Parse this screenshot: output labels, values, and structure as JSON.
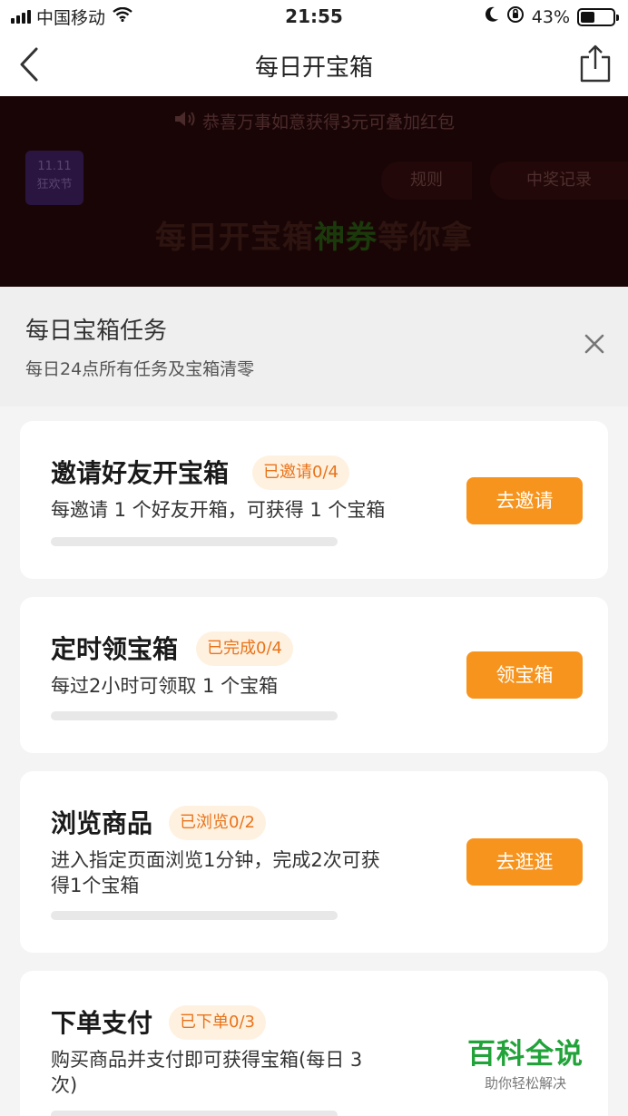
{
  "status_bar": {
    "carrier": "中国移动",
    "time": "21:55",
    "battery": "43%",
    "battery_level": 0.43
  },
  "nav": {
    "title": "每日开宝箱",
    "back_icon": "chevron-left-icon",
    "share_icon": "share-icon"
  },
  "banner": {
    "notice": "恭喜万事如意获得3元可叠加红包",
    "badge_line1": "11.11",
    "badge_line2": "狂欢节",
    "rules": "规则",
    "records": "中奖记录",
    "slogan_a": "每日开宝箱",
    "slogan_b": "神券",
    "slogan_c": "等你拿"
  },
  "sheet": {
    "title": "每日宝箱任务",
    "subtitle": "每日24点所有任务及宝箱清零",
    "close_icon": "close-icon"
  },
  "tasks": [
    {
      "title": "邀请好友开宝箱",
      "tag": "已邀请0/4",
      "desc": "每邀请 1 个好友开箱，可获得 1 个宝箱",
      "button": "去邀请",
      "progress": 0
    },
    {
      "title": "定时领宝箱",
      "tag": "已完成0/4",
      "desc": "每过2小时可领取 1 个宝箱",
      "button": "领宝箱",
      "progress": 0
    },
    {
      "title": "浏览商品",
      "tag": "已浏览0/2",
      "desc_line1": "进入指定页面浏览1分钟，完成2次可获",
      "desc_line2": "得1个宝箱",
      "button": "去逛逛",
      "progress": 0
    },
    {
      "title": "下单支付",
      "tag": "已下单0/3",
      "desc_line1": "购买商品并支付即可获得宝箱(每日 3",
      "desc_line2": "次)",
      "progress": 0
    }
  ],
  "watermark": {
    "big": "百科全说",
    "small": "助你轻松解决"
  },
  "colors": {
    "accent": "#f7941d",
    "tag_bg": "#fff1e0",
    "tag_text": "#e8731a",
    "watermark": "#22a33a"
  }
}
